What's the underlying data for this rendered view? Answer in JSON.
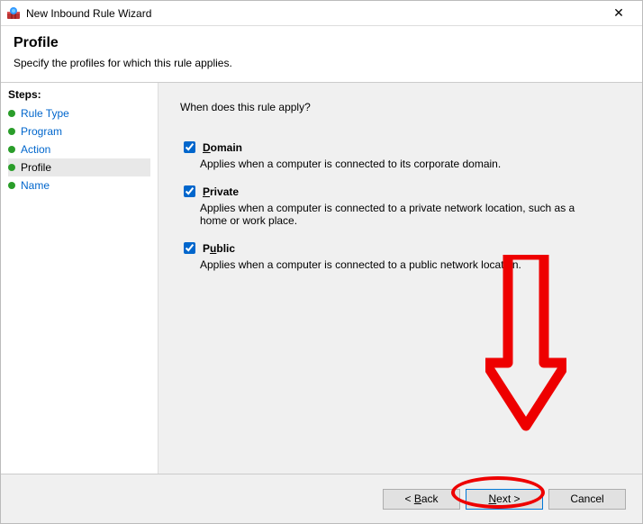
{
  "window": {
    "title": "New Inbound Rule Wizard",
    "close_label": "✕"
  },
  "header": {
    "title": "Profile",
    "subtitle": "Specify the profiles for which this rule applies."
  },
  "sidebar": {
    "label": "Steps:",
    "items": [
      {
        "label": "Rule Type",
        "current": false
      },
      {
        "label": "Program",
        "current": false
      },
      {
        "label": "Action",
        "current": false
      },
      {
        "label": "Profile",
        "current": true
      },
      {
        "label": "Name",
        "current": false
      }
    ]
  },
  "main": {
    "question": "When does this rule apply?",
    "options": [
      {
        "accel": "D",
        "rest": "omain",
        "name": "Domain",
        "desc": "Applies when a computer is connected to its corporate domain.",
        "checked": true
      },
      {
        "accel": "P",
        "rest": "rivate",
        "name": "Private",
        "desc": "Applies when a computer is connected to a private network location, such as a home or work place.",
        "checked": true
      },
      {
        "accel": "P",
        "rest_pre": "Pu",
        "rest": "lic",
        "accel2": "b",
        "name": "Public",
        "desc": "Applies when a computer is connected to a public network location.",
        "checked": true
      }
    ]
  },
  "footer": {
    "back": "< Back",
    "next": "Next >",
    "cancel": "Cancel"
  },
  "annotation": {
    "type": "arrow-and-circle",
    "color": "#ee0000",
    "target": "next-button"
  }
}
